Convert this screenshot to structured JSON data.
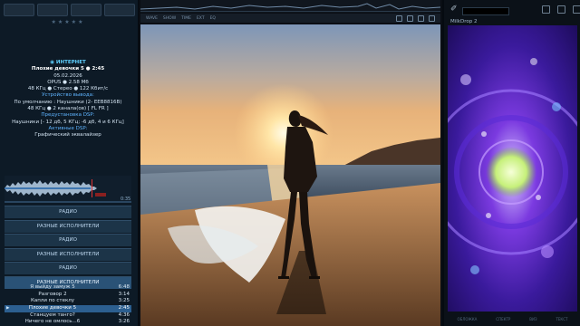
{
  "left_panel": {
    "stars": "★★★★★",
    "info": {
      "source": "ИНТЕРНЕТ",
      "track_line": "Плохие девочки 5 ● 2:45",
      "date": "05.02.2026",
      "format": "OPUS ● 2.58 Мб",
      "params": "48 КГц ● Стерео ● 122 Кбит/с",
      "output_label": "Устройство вывода:",
      "output_device": "По умолчанию : Наушники (2- EEB8816B)",
      "output_params": "48 КГц ● 2 канала(ов) [ FL FR ]",
      "dsp_preset_label": "Предустановка DSP:",
      "dsp_preset": "Наушники [- 12 дб, 5 КГц; -6 дб, 4 и 6 КГц]",
      "active_dsp_label": "Активные DSP:",
      "active_dsp": "Графический эквалайзер"
    },
    "time_remaining": "0:35",
    "playlists": [
      {
        "label": "РАДИО",
        "active": false
      },
      {
        "label": "РАЗНЫЕ ИСПОЛНИТЕЛИ",
        "active": false
      },
      {
        "label": "РАДИО",
        "active": false
      },
      {
        "label": "РАЗНЫЕ ИСПОЛНИТЕЛИ",
        "active": false
      },
      {
        "label": "РАДИО",
        "active": false
      },
      {
        "label": "РАЗНЫЕ ИСПОЛНИТЕЛИ",
        "active": true
      }
    ],
    "tracks": [
      {
        "title": "Я выйду замуж 5",
        "duration": "6:48",
        "playing": false
      },
      {
        "title": "Разговор 2",
        "duration": "3:14",
        "playing": false
      },
      {
        "title": "Капли по стеклу",
        "duration": "3:25",
        "playing": false
      },
      {
        "title": "Плохие девочки 5",
        "duration": "2:45",
        "playing": true
      },
      {
        "title": "Станцуем танго?",
        "duration": "4:36",
        "playing": false
      },
      {
        "title": "Ничего не омлось...6",
        "duration": "3:26",
        "playing": false
      }
    ]
  },
  "center": {
    "toolbar_labels": [
      "WAVE",
      "SHOW",
      "TIME",
      "EXT",
      "EQ"
    ]
  },
  "right_panel": {
    "visualizer_title": "MilkDrop 2",
    "bottom_tabs": [
      "ОБЛОЖКА",
      "СПЕКТР",
      "ВИЗ",
      "ТЕКСТ"
    ]
  },
  "colors": {
    "accent": "#5fb4ff",
    "active_row": "#2c5f90",
    "panel_bg": "#0d1a26"
  }
}
